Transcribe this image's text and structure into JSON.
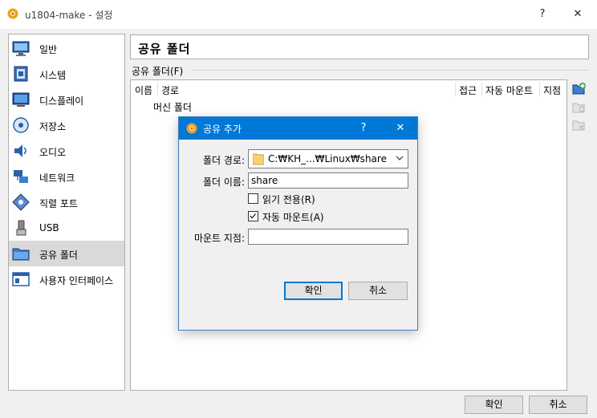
{
  "window": {
    "title": "u1804-make - 설정",
    "help": "?",
    "close": "✕"
  },
  "sidebar": {
    "items": [
      {
        "label": "일반",
        "icon": "monitor-icon"
      },
      {
        "label": "시스템",
        "icon": "chip-icon"
      },
      {
        "label": "디스플레이",
        "icon": "display-icon"
      },
      {
        "label": "저장소",
        "icon": "storage-icon"
      },
      {
        "label": "오디오",
        "icon": "speaker-icon"
      },
      {
        "label": "네트워크",
        "icon": "network-icon"
      },
      {
        "label": "직렬 포트",
        "icon": "serial-port-icon"
      },
      {
        "label": "USB",
        "icon": "usb-icon"
      },
      {
        "label": "공유 폴더",
        "icon": "folder-icon"
      },
      {
        "label": "사용자 인터페이스",
        "icon": "ui-window-icon"
      }
    ],
    "selected_index": 8
  },
  "main": {
    "page_title": "공유 폴더",
    "group_label": "공유 폴더(F)",
    "table": {
      "columns": [
        "이름",
        "경로",
        "접근",
        "자동 마운트",
        "지점"
      ],
      "rows": [
        "머신 폴더"
      ]
    }
  },
  "footer": {
    "ok": "확인",
    "cancel": "취소"
  },
  "dialog": {
    "title": "공유 추가",
    "help": "?",
    "close": "✕",
    "folder_path_label": "폴더 경로:",
    "folder_path_value": "C:₩KH_...₩Linux₩share",
    "folder_name_label": "폴더 이름:",
    "folder_name_value": "share",
    "readonly_label": "읽기 전용(R)",
    "readonly_checked": false,
    "automount_label": "자동 마운트(A)",
    "automount_checked": true,
    "mount_point_label": "마운트 지점:",
    "mount_point_value": "",
    "ok": "확인",
    "cancel": "취소"
  },
  "colors": {
    "accent": "#0078d7",
    "selected_bg": "#d9d9d9",
    "border": "#adadad"
  }
}
